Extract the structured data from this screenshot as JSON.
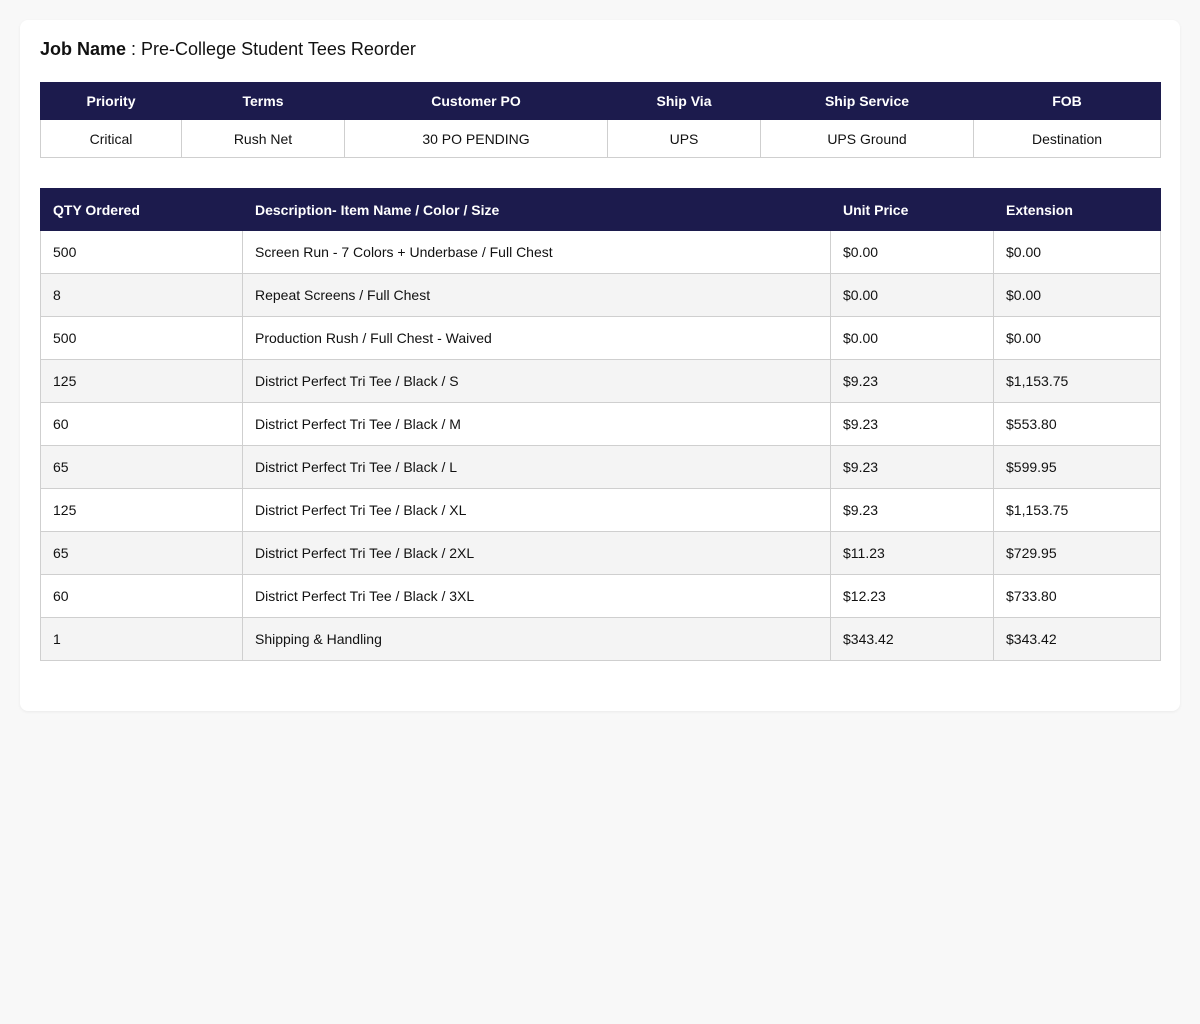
{
  "job": {
    "label": "Job Name",
    "separator": " : ",
    "name": "Pre-College Student Tees Reorder"
  },
  "info": {
    "headers": [
      "Priority",
      "Terms",
      "Customer PO",
      "Ship Via",
      "Ship Service",
      "FOB"
    ],
    "values": [
      "Critical",
      "Rush Net",
      "30 PO PENDING",
      "UPS",
      "UPS Ground",
      "Destination"
    ]
  },
  "items": {
    "headers": [
      "QTY Ordered",
      "Description- Item Name / Color / Size",
      "Unit Price",
      "Extension"
    ],
    "rows": [
      [
        "500",
        "Screen Run - 7 Colors + Underbase / Full Chest",
        "$0.00",
        "$0.00"
      ],
      [
        "8",
        "Repeat Screens / Full Chest",
        "$0.00",
        "$0.00"
      ],
      [
        "500",
        "Production Rush / Full Chest - Waived",
        "$0.00",
        "$0.00"
      ],
      [
        "125",
        "District Perfect Tri Tee / Black / S",
        "$9.23",
        "$1,153.75"
      ],
      [
        "60",
        "District Perfect Tri Tee / Black / M",
        "$9.23",
        "$553.80"
      ],
      [
        "65",
        "District Perfect Tri Tee / Black / L",
        "$9.23",
        "$599.95"
      ],
      [
        "125",
        "District Perfect Tri Tee / Black / XL",
        "$9.23",
        "$1,153.75"
      ],
      [
        "65",
        "District Perfect Tri Tee / Black / 2XL",
        "$11.23",
        "$729.95"
      ],
      [
        "60",
        "District Perfect Tri Tee / Black / 3XL",
        "$12.23",
        "$733.80"
      ],
      [
        "1",
        "Shipping & Handling",
        "$343.42",
        "$343.42"
      ]
    ]
  },
  "colors": {
    "header_bg": "#1c1b4d",
    "header_text": "#ffffff",
    "row_alt": "#f4f4f4",
    "border": "#cfcfcf"
  }
}
